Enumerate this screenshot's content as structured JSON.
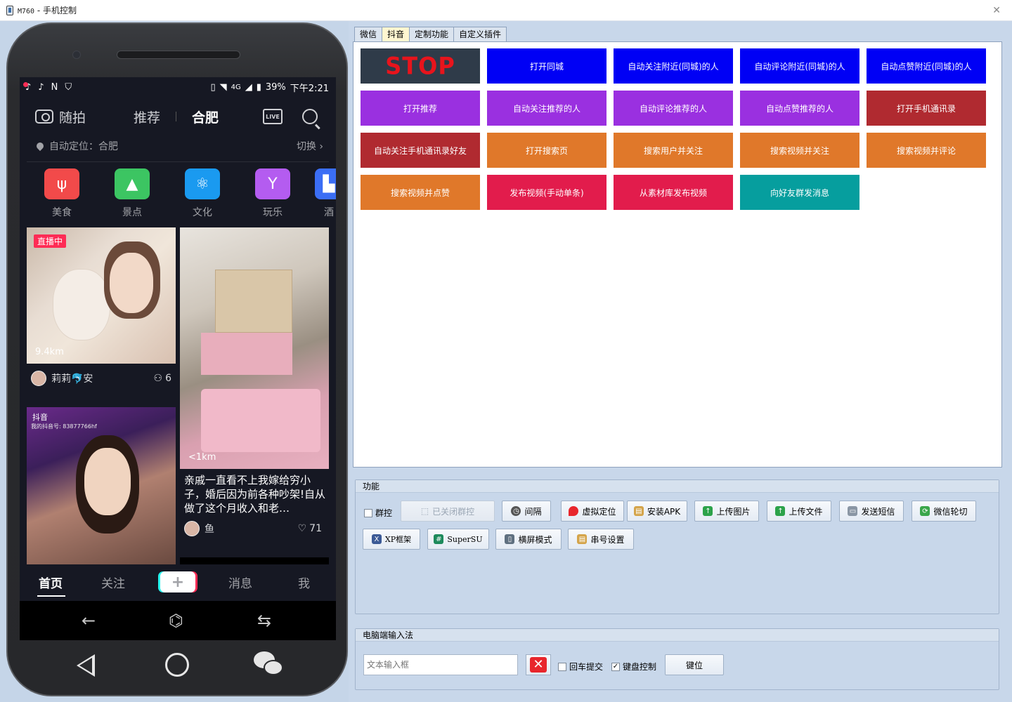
{
  "window": {
    "device": "M760",
    "title": " - 手机控制"
  },
  "phone": {
    "status": {
      "battery": "39%",
      "time": "下午2:21",
      "network": "4G"
    },
    "topnav": {
      "camera_label": "随拍",
      "tab_recommend": "推荐",
      "tab_city": "合肥",
      "live_label": "LIVE"
    },
    "location": {
      "text": "自动定位：合肥",
      "switch": "切换 ›"
    },
    "categories": [
      {
        "label": "美食",
        "color": "#f24a4a",
        "icon": "fork-icon"
      },
      {
        "label": "景点",
        "color": "#3cc562",
        "icon": "landscape-icon"
      },
      {
        "label": "文化",
        "color": "#1a9af0",
        "icon": "atom-icon"
      },
      {
        "label": "玩乐",
        "color": "#b45cf0",
        "icon": "cocktail-icon"
      },
      {
        "label": "酒",
        "color": "#3b6ef5",
        "icon": "hotel-icon"
      }
    ],
    "feed": {
      "card1": {
        "badge": "直播中",
        "distance": "9.4km",
        "user": "莉莉🐬安",
        "viewers": "6"
      },
      "card2": {
        "distance": "<1km",
        "desc": "亲戚一直看不上我嫁给穷小子，婚后因为前各种吵架!自从做了这个月收入和老…",
        "user": "鱼",
        "likes": "71"
      },
      "card3": {
        "watermark": "抖音",
        "watermark_id": "我的抖音号: 83877766hf"
      }
    },
    "bottomnav": {
      "home": "首页",
      "follow": "关注",
      "plus": "+",
      "messages": "消息",
      "me": "我"
    }
  },
  "tabs": [
    "微信",
    "抖音",
    "定制功能",
    "自定义插件"
  ],
  "active_tab": "抖音",
  "function_buttons": {
    "stop": "STOP",
    "row1": [
      "打开同城",
      "自动关注附近(同城)的人",
      "自动评论附近(同城)的人",
      "自动点赞附近(同城)的人"
    ],
    "row2": [
      "打开推荐",
      "自动关注推荐的人",
      "自动评论推荐的人",
      "自动点赞推荐的人",
      "打开手机通讯录"
    ],
    "row3": [
      "自动关注手机通讯录好友",
      "打开搜索页",
      "搜索用户并关注",
      "搜索视频并关注",
      "搜索视频并评论"
    ],
    "row4": [
      "搜索视频并点赞",
      "发布视频(手动单条)",
      "从素材库发布视频",
      "向好友群发消息"
    ]
  },
  "colors": {
    "blue": "#0000f5",
    "purple": "#9a30e0",
    "darkred": "#b02a30",
    "orange": "#e0782a",
    "crimson": "#e21c4c",
    "teal": "#069e9e",
    "stop_bg": "#2f3b49",
    "stop_text": "#e8141c"
  },
  "func_group": {
    "title": "功能",
    "group_control": "群控",
    "group_closed": "已关闭群控",
    "buttons": [
      "间隔",
      "虚拟定位",
      "安装APK",
      "上传图片",
      "上传文件",
      "发送短信",
      "微信轮切"
    ],
    "buttons2": [
      "XP框架",
      "SuperSU",
      "横屏模式",
      "串号设置"
    ]
  },
  "input_group": {
    "title": "电脑端输入法",
    "placeholder": "文本输入框",
    "enter_submit": "回车提交",
    "keyboard_control": "键盘控制",
    "keypos": "键位"
  }
}
